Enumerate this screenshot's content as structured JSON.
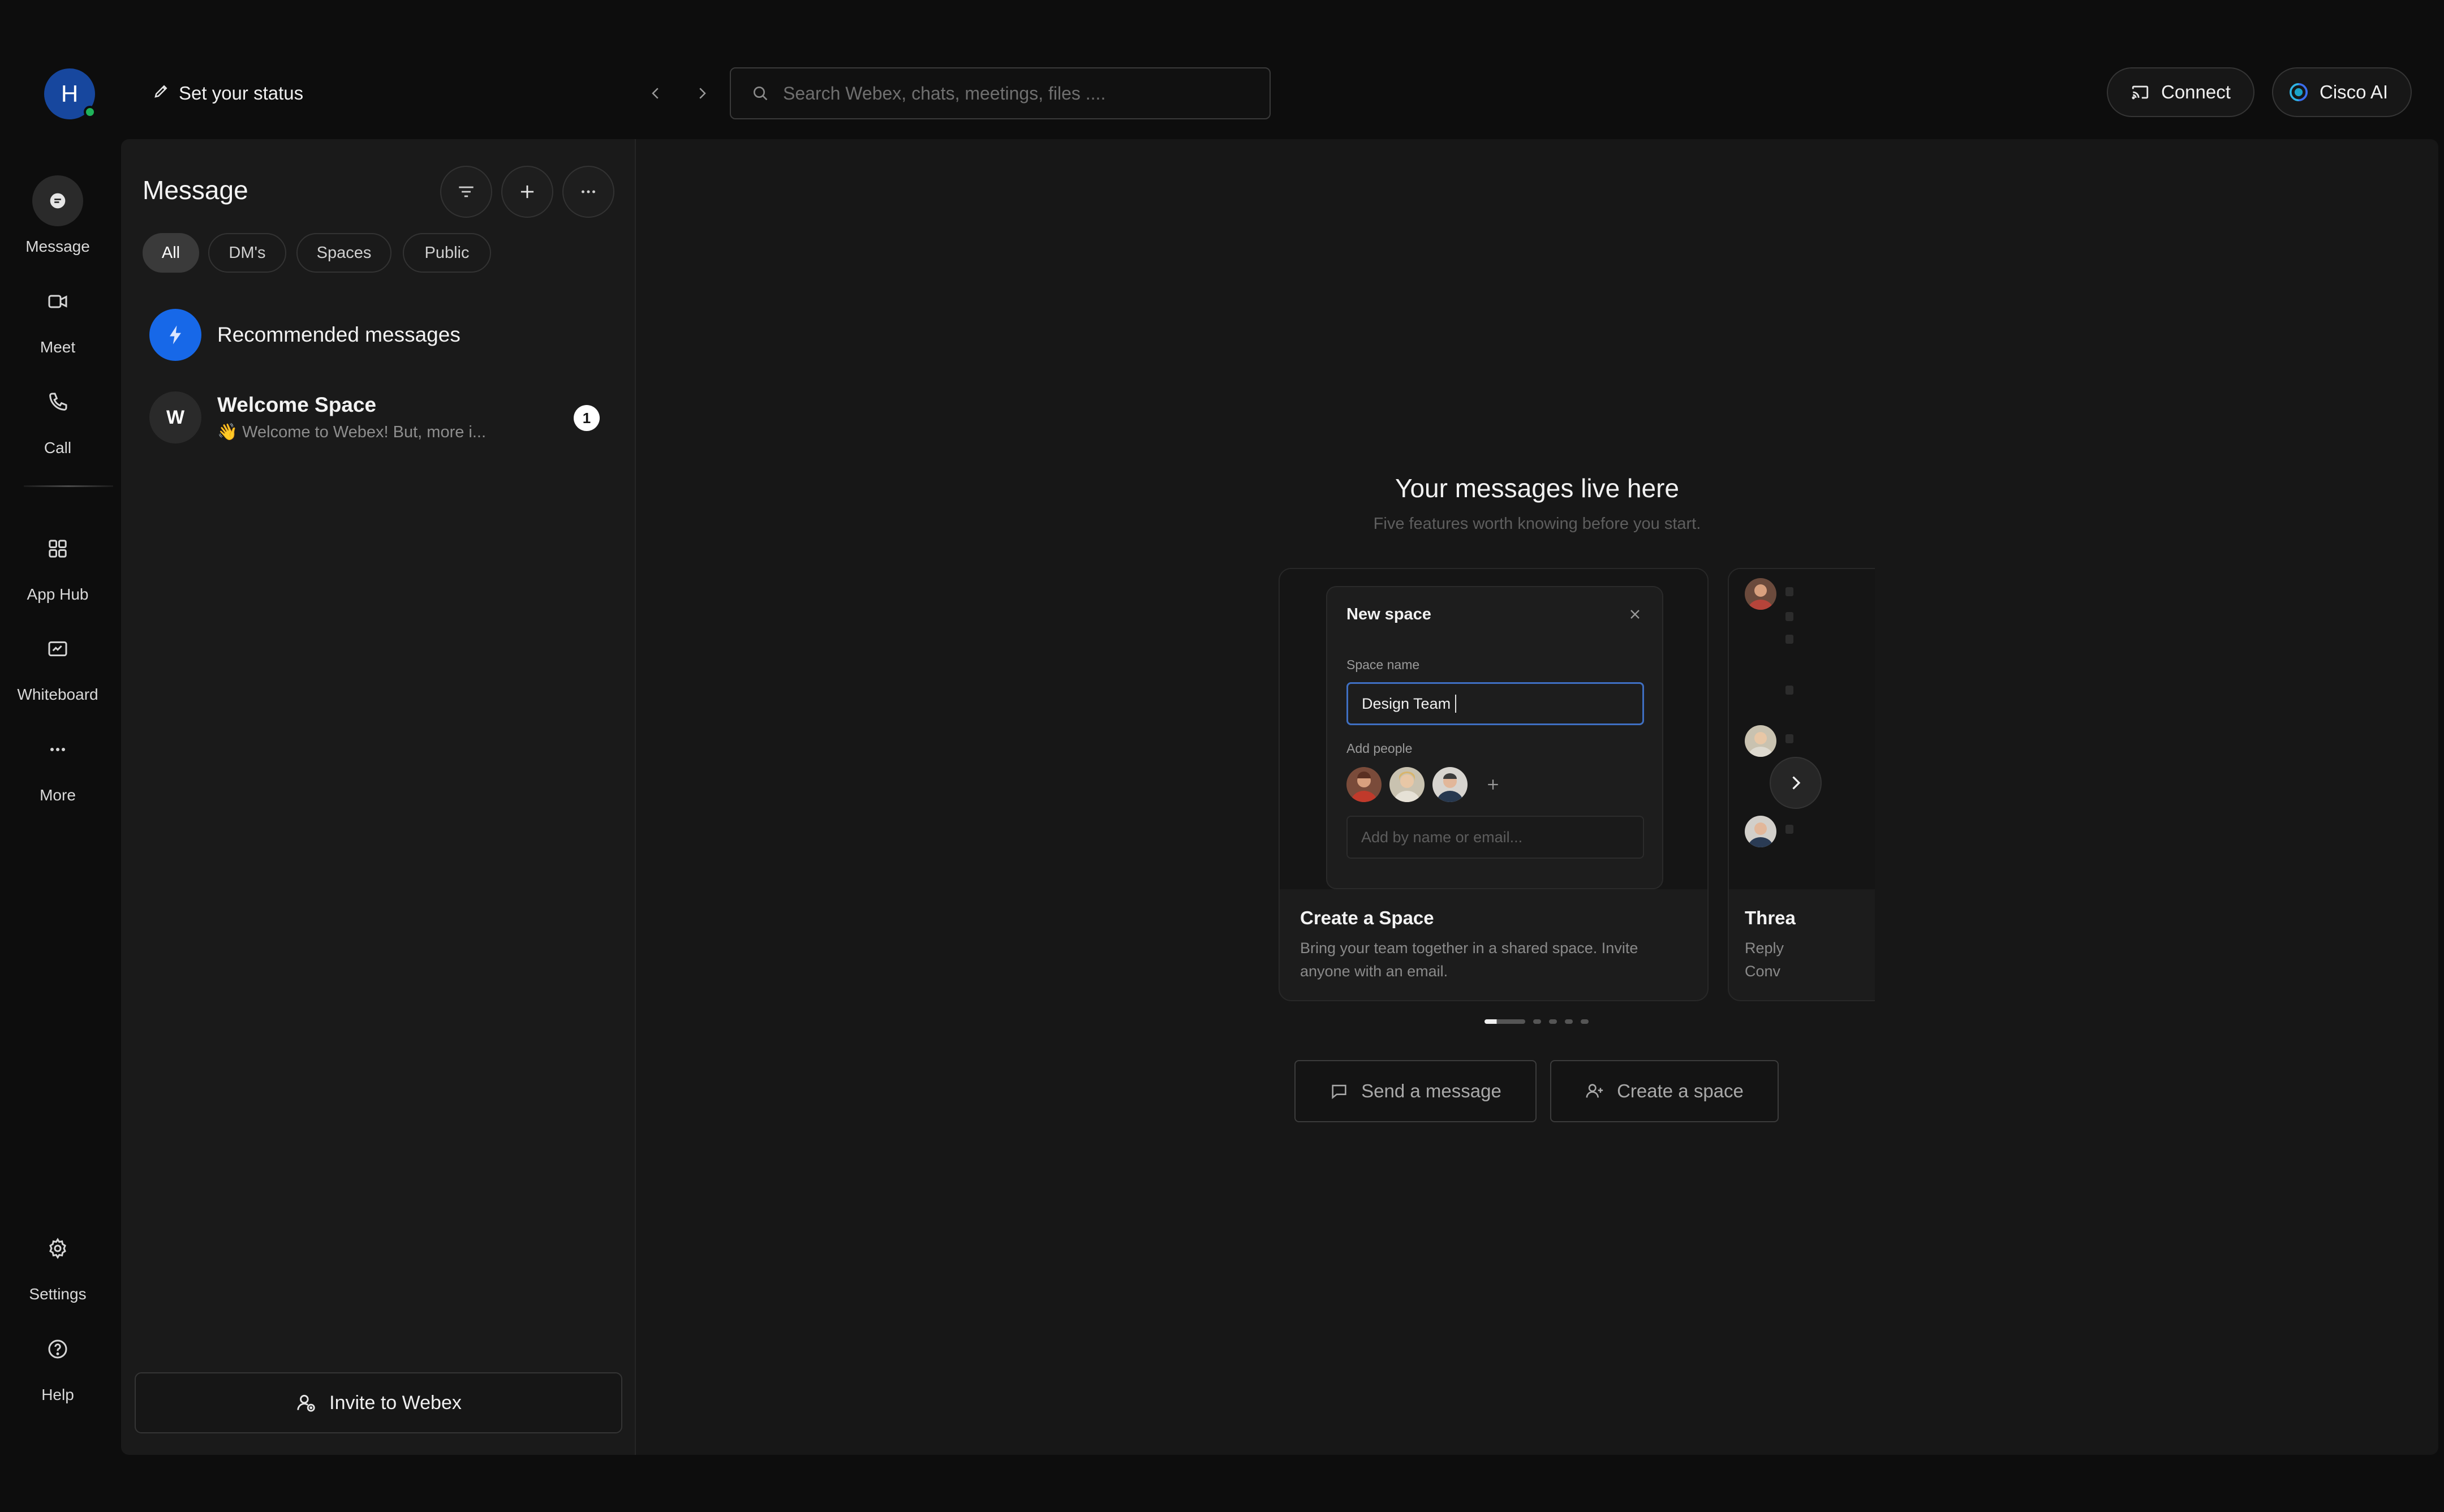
{
  "user": {
    "initial": "H",
    "presence": "online"
  },
  "topbar": {
    "status_label": "Set your status",
    "search_placeholder": "Search Webex, chats, meetings, files ....",
    "connect_label": "Connect",
    "ai_label": "Cisco AI"
  },
  "rail": {
    "message": "Message",
    "meet": "Meet",
    "call": "Call",
    "apphub": "App Hub",
    "whiteboard": "Whiteboard",
    "more": "More",
    "settings": "Settings",
    "help": "Help"
  },
  "panel": {
    "title": "Message",
    "filters": [
      "All",
      "DM's",
      "Spaces",
      "Public"
    ],
    "active_filter": "All",
    "recommended": "Recommended messages",
    "conversations": [
      {
        "initial": "W",
        "title": "Welcome Space",
        "preview": "👋 Welcome to Webex! But, more i...",
        "unread": "1"
      }
    ],
    "invite_label": "Invite to Webex"
  },
  "main": {
    "title": "Your messages live here",
    "subtitle": "Five features worth knowing before you start.",
    "cards": [
      {
        "preview": {
          "dialog_title": "New space",
          "space_name_label": "Space name",
          "space_name_value": "Design Team",
          "add_people_label": "Add people",
          "add_placeholder": "Add by name or email..."
        },
        "heading": "Create a Space",
        "description": "Bring your team together in a shared space. Invite anyone with an email."
      },
      {
        "heading": "Threa",
        "description": "Reply\nConv"
      }
    ],
    "pages": 5,
    "active_page": 1,
    "send_label": "Send a message",
    "create_label": "Create a space"
  },
  "colors": {
    "background": "#0d0d0d",
    "panel": "#1a1a1a",
    "accent_blue": "#1768e8",
    "avatar_blue": "#17479e",
    "presence_green": "#1fb35a"
  }
}
